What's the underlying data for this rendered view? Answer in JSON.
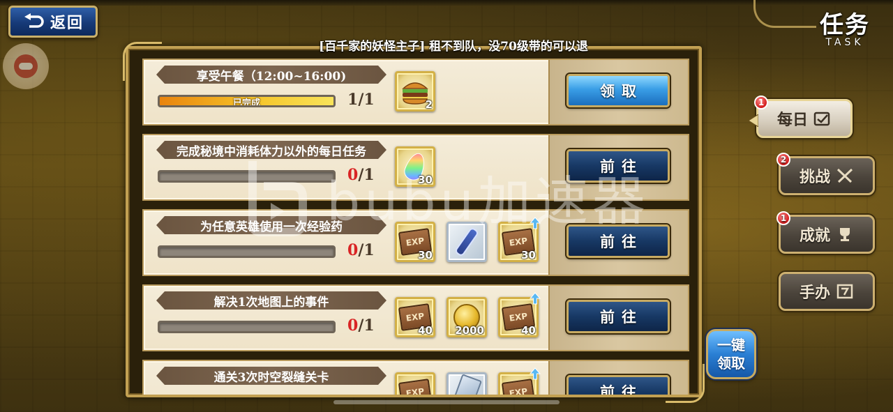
{
  "header": {
    "back_label": "返回",
    "title_zh": "任务",
    "title_en": "TASK",
    "announcement": "[百千家的妖怪主子] 租不到队，没70级带的可以退"
  },
  "tasks": [
    {
      "title": "享受午餐（12:00~16:00)",
      "progress_fraction": 1.0,
      "progress_label": "已完成",
      "count_current": "1",
      "count_total": "/1",
      "rewards": [
        {
          "icon": "burger-icon",
          "qty": "2"
        }
      ],
      "button_label": "领取",
      "button_type": "claim"
    },
    {
      "title": "完成秘境中消耗体力以外的每日任务",
      "progress_fraction": 0,
      "progress_label": "",
      "count_current": "0",
      "count_total": "/1",
      "rewards": [
        {
          "icon": "rainbow-gem-icon",
          "qty": "30"
        }
      ],
      "button_label": "前往",
      "button_type": "go"
    },
    {
      "title": "为任意英雄使用一次经验药",
      "progress_fraction": 0,
      "progress_label": "",
      "count_current": "0",
      "count_total": "/1",
      "rewards": [
        {
          "icon": "exp-ticket-icon",
          "label": "EXP",
          "qty": "30"
        },
        {
          "icon": "potion-icon",
          "qty": ""
        },
        {
          "icon": "exp-ticket-up-icon",
          "label": "EXP",
          "qty": "30"
        }
      ],
      "button_label": "前往",
      "button_type": "go"
    },
    {
      "title": "解决1次地图上的事件",
      "progress_fraction": 0,
      "progress_label": "",
      "count_current": "0",
      "count_total": "/1",
      "rewards": [
        {
          "icon": "exp-ticket-icon",
          "label": "EXP",
          "qty": "40"
        },
        {
          "icon": "gold-coin-icon",
          "qty": "2000"
        },
        {
          "icon": "exp-ticket-up-icon",
          "label": "EXP",
          "qty": "40"
        }
      ],
      "button_label": "前往",
      "button_type": "go"
    },
    {
      "title": "通关3次时空裂缝关卡",
      "progress_fraction": 0,
      "progress_label": "",
      "count_current": "",
      "count_total": "",
      "rewards": [
        {
          "icon": "exp-ticket-icon",
          "label": "EXP",
          "qty": ""
        },
        {
          "icon": "scroll-card-icon",
          "qty": ""
        },
        {
          "icon": "exp-ticket-up-icon",
          "label": "EXP",
          "qty": ""
        }
      ],
      "button_label": "前往",
      "button_type": "go"
    }
  ],
  "side_tabs": [
    {
      "label": "每日",
      "badge": "1",
      "icon": "calendar-icon",
      "active": true
    },
    {
      "label": "挑战",
      "badge": "2",
      "icon": "crossed-swords-icon",
      "active": false
    },
    {
      "label": "成就",
      "badge": "1",
      "icon": "trophy-icon",
      "active": false
    },
    {
      "label": "手办",
      "badge": "",
      "icon": "figure-box-icon",
      "active": false
    }
  ],
  "onekey": {
    "line1": "一键",
    "line2": "领取"
  },
  "watermark": {
    "text": "bubu加速器"
  },
  "colors": {
    "claim_button": "#3a9ee6",
    "go_button": "#173864",
    "progress_fill": "#f5c52a",
    "badge_red": "#d21a1a",
    "count_red": "#d92424",
    "frame_gold": "#c2a052"
  }
}
